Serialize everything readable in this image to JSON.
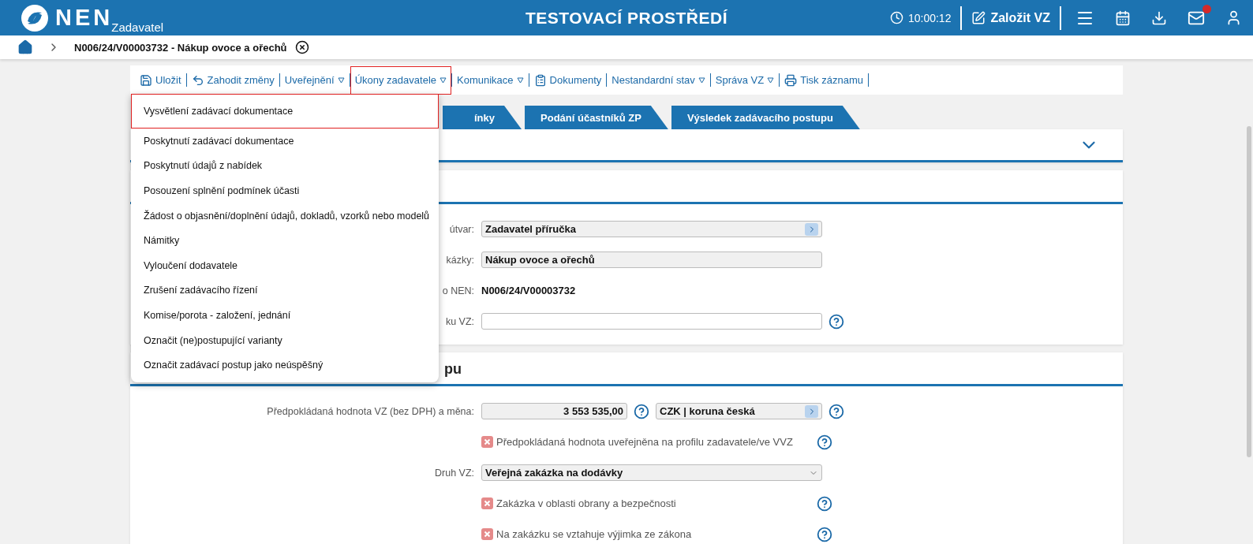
{
  "header": {
    "logo": "NEN",
    "subtitle": "Zadavatel",
    "environment": "TESTOVACÍ PROSTŘEDÍ",
    "time": "10:00:12",
    "create_button": "Založit VZ",
    "mail_unread": true
  },
  "breadcrumb": {
    "title": "N006/24/V00003732 - Nákup ovoce a ořechů"
  },
  "toolbar": [
    {
      "label": "Uložit",
      "dropdown": false,
      "selected": false
    },
    {
      "label": "Zahodit změny",
      "dropdown": false,
      "selected": false
    },
    {
      "label": "Uveřejnění",
      "dropdown": true,
      "selected": false
    },
    {
      "label": "Úkony zadavatele",
      "dropdown": true,
      "selected": true
    },
    {
      "label": "Komunikace",
      "dropdown": true,
      "selected": false
    },
    {
      "label": "Dokumenty",
      "dropdown": false,
      "selected": false
    },
    {
      "label": "Nestandardní stav",
      "dropdown": true,
      "selected": false
    },
    {
      "label": "Správa VZ",
      "dropdown": true,
      "selected": false
    },
    {
      "label": "Tisk záznamu",
      "dropdown": false,
      "selected": false
    }
  ],
  "menu": [
    {
      "label": "Vysvětlení zadávací dokumentace",
      "selected": true
    },
    {
      "label": "Poskytnutí zadávací dokumentace",
      "selected": false
    },
    {
      "label": "Poskytnutí údajů z nabídek",
      "selected": false
    },
    {
      "label": "Posouzení splnění podmínek účasti",
      "selected": false
    },
    {
      "label": "Žádost o objasnění/doplnění údajů, dokladů, vzorků nebo modelů",
      "selected": false
    },
    {
      "label": "Námitky",
      "selected": false
    },
    {
      "label": "Vyloučení dodavatele",
      "selected": false
    },
    {
      "label": "Zrušení zadávacího řízení",
      "selected": false
    },
    {
      "label": "Komise/porota - založení, jednání",
      "selected": false
    },
    {
      "label": "Označit (ne)postupující varianty",
      "selected": false
    },
    {
      "label": "Označit zadávací postup jako neúspěšný",
      "selected": false
    }
  ],
  "tabs": [
    {
      "label": "ínky"
    },
    {
      "label": "Podání účastníků ZP"
    },
    {
      "label": "Výsledek zadávacího postupu"
    }
  ],
  "collapsed_section": {
    "expanded": false
  },
  "general_section": {
    "rows": [
      {
        "kind": "select",
        "label": "útvar:",
        "value": "Zadavatel příručka",
        "help": false
      },
      {
        "kind": "readonly",
        "label": "kázky:",
        "value": "Nákup ovoce a ořechů",
        "help": false
      },
      {
        "kind": "text",
        "label": "o NEN:",
        "value": "N006/24/V00003732",
        "help": false
      },
      {
        "kind": "input",
        "label": "ku VZ:",
        "value": "",
        "help": true
      }
    ]
  },
  "value_section": {
    "title": "pu",
    "rows": [
      {
        "kind": "amount",
        "label": "Předpokládaná hodnota VZ (bez DPH) a měna:",
        "value": "3 553 535,00",
        "currency": "CZK | koruna česká",
        "help": true
      },
      {
        "kind": "checkbox",
        "label": "Předpokládaná hodnota uveřejněna na profilu zadavatele/ve VVZ",
        "checked": false,
        "help": true
      },
      {
        "kind": "dropdown",
        "label": "Druh VZ:",
        "value": "Veřejná zakázka na dodávky",
        "help": false
      },
      {
        "kind": "checkbox",
        "label": "Zakázka v oblasti obrany a bezpečnosti",
        "checked": false,
        "help": true
      },
      {
        "kind": "checkbox",
        "label": "Na zakázku se vztahuje výjimka ze zákona",
        "checked": false,
        "help": true
      }
    ]
  }
}
